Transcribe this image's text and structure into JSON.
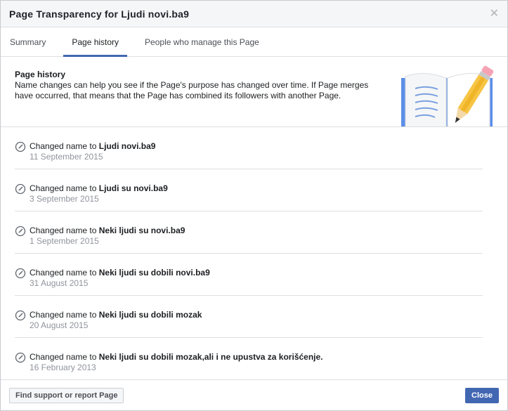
{
  "dialog": {
    "title": "Page Transparency for Ljudi novi.ba9",
    "close_icon": "close-icon"
  },
  "tabs": [
    {
      "label": "Summary",
      "active": false
    },
    {
      "label": "Page history",
      "active": true
    },
    {
      "label": "People who manage this Page",
      "active": false
    }
  ],
  "banner": {
    "heading": "Page history",
    "text": "Name changes can help you see if the Page's purpose has changed over time. If Page merges have occurred, that means that the Page has combined its followers with another Page.",
    "illustration_icon": "open-book-pencil-illustration"
  },
  "history": [
    {
      "prefix": "Changed name to",
      "name": "Ljudi novi.ba9",
      "date": "11 September 2015",
      "icon": "edit-icon"
    },
    {
      "prefix": "Changed name to",
      "name": "Ljudi su novi.ba9",
      "date": "3 September 2015",
      "icon": "edit-icon"
    },
    {
      "prefix": "Changed name to",
      "name": "Neki ljudi su novi.ba9",
      "date": "1 September 2015",
      "icon": "edit-icon"
    },
    {
      "prefix": "Changed name to",
      "name": "Neki ljudi su dobili novi.ba9",
      "date": "31 August 2015",
      "icon": "edit-icon"
    },
    {
      "prefix": "Changed name to",
      "name": "Neki ljudi su dobili mozak",
      "date": "20 August 2015",
      "icon": "edit-icon"
    },
    {
      "prefix": "Changed name to",
      "name": "Neki ljudi su dobili mozak,ali i ne upustva za korišćenje.",
      "date": "16 February 2013",
      "icon": "edit-icon"
    }
  ],
  "footer": {
    "report_label": "Find support or report Page",
    "close_label": "Close"
  },
  "colors": {
    "accent": "#4267b2",
    "muted_text": "#90949c"
  }
}
